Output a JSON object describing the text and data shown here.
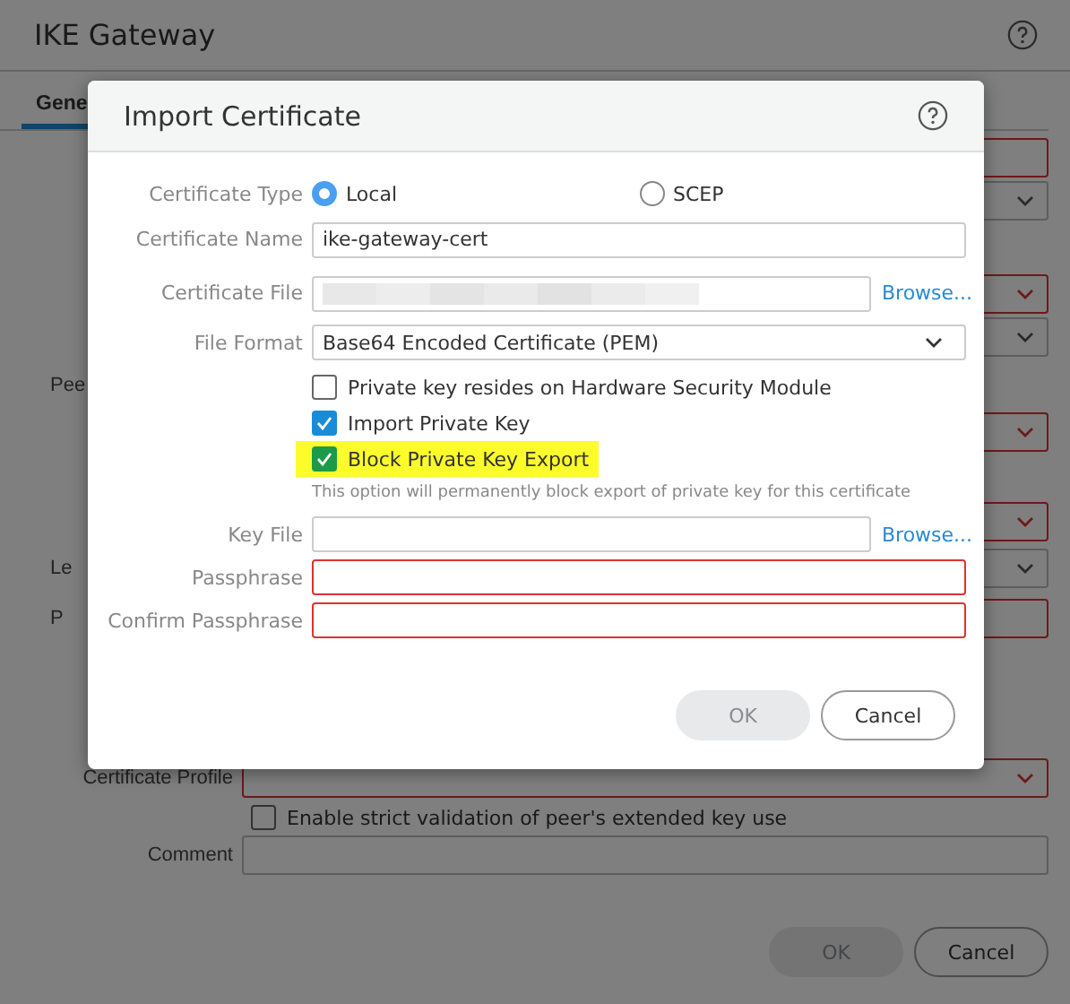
{
  "window": {
    "title": "IKE Gateway"
  },
  "tabs": [
    {
      "label": "Gene",
      "selected": true
    }
  ],
  "background_rows": [
    {
      "kind": "input",
      "invalid": true
    },
    {
      "kind": "select",
      "invalid": false
    },
    {
      "kind": "select",
      "invalid": true
    },
    {
      "kind": "select",
      "invalid": false
    },
    {
      "kind": "label",
      "label": "Pee",
      "cut": true
    },
    {
      "kind": "select",
      "invalid": true
    },
    {
      "kind": "select",
      "invalid": true
    },
    {
      "kind": "select",
      "label": "Le",
      "cut": true,
      "invalid": false
    },
    {
      "kind": "input",
      "label": "P",
      "cut": true,
      "invalid": true
    },
    {
      "kind": "select",
      "label": "Certificate Profile",
      "cut": false,
      "invalid": true
    },
    {
      "kind": "checkbox",
      "text": "Enable strict validation of peer's extended key use",
      "checked": false
    },
    {
      "kind": "input",
      "label": "Comment",
      "cut": false,
      "invalid": false
    }
  ],
  "buttons": [
    {
      "label": "OK",
      "disabled": true
    },
    {
      "label": "Cancel",
      "disabled": false
    }
  ],
  "dialog": {
    "title": "Import Certificate",
    "certificate_type": {
      "label": "Certificate Type",
      "options": [
        {
          "label": "Local",
          "selected": true
        },
        {
          "label": "SCEP",
          "selected": false
        }
      ]
    },
    "certificate_name": {
      "label": "Certificate Name",
      "value": "ike-gateway-cert"
    },
    "certificate_file": {
      "label": "Certificate File",
      "link": "Browse..."
    },
    "file_format": {
      "label": "File Format",
      "value": "Base64 Encoded Certificate (PEM)"
    },
    "options": [
      {
        "label": "Private key resides on Hardware Security Module",
        "checked": false,
        "highlighted": false
      },
      {
        "label": "Import Private Key",
        "checked": true,
        "highlighted": false
      },
      {
        "label": "Block Private Key Export",
        "checked": true,
        "highlighted": true
      }
    ],
    "hint": "This option will permanently block export of private key for this certificate",
    "key_file": {
      "label": "Key File",
      "link": "Browse..."
    },
    "passphrase": {
      "label": "Passphrase",
      "invalid": true
    },
    "confirm_passphrase": {
      "label": "Confirm Passphrase",
      "invalid": true
    },
    "buttons": [
      {
        "label": "OK",
        "disabled": true
      },
      {
        "label": "Cancel",
        "disabled": false
      }
    ]
  }
}
